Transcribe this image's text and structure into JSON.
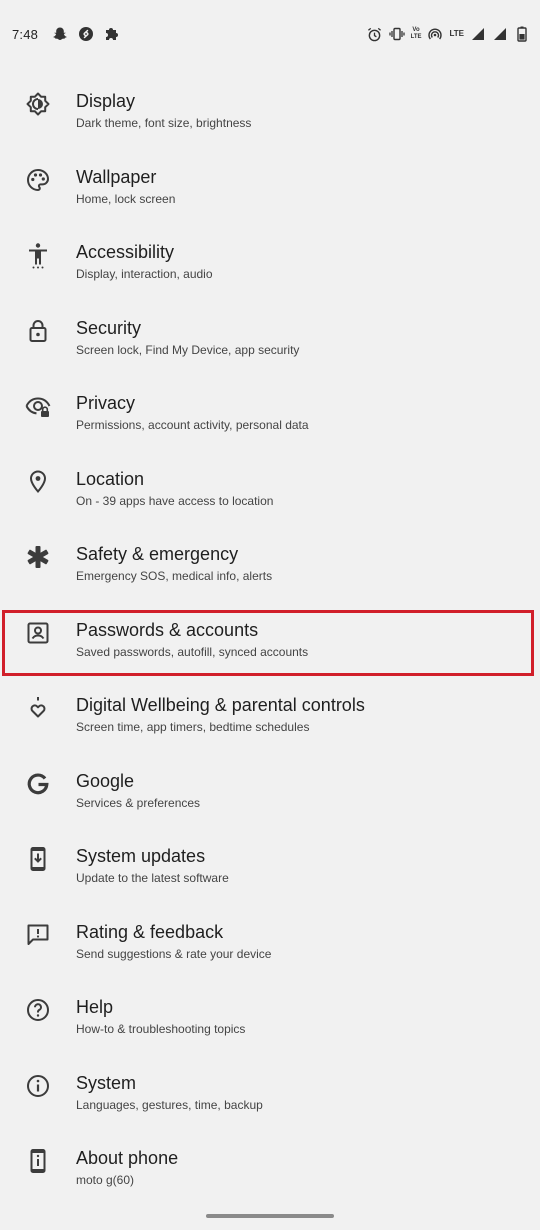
{
  "status_bar": {
    "time": "7:48",
    "left_icons": [
      "snapchat-icon",
      "shazam-icon",
      "puzzle-icon"
    ],
    "right_icons": [
      "alarm-icon",
      "vibrate-icon",
      "volte-icon",
      "hotspot-icon",
      "signal-icon",
      "signal-icon",
      "battery-icon"
    ],
    "volte_top": "Vo",
    "volte_bottom": "LTE",
    "lte_label": "LTE"
  },
  "settings": [
    {
      "title": "Display",
      "subtitle": "Dark theme, font size, brightness",
      "icon": "display-brightness-icon"
    },
    {
      "title": "Wallpaper",
      "subtitle": "Home, lock screen",
      "icon": "palette-icon"
    },
    {
      "title": "Accessibility",
      "subtitle": "Display, interaction, audio",
      "icon": "accessibility-icon"
    },
    {
      "title": "Security",
      "subtitle": "Screen lock, Find My Device, app security",
      "icon": "lock-icon"
    },
    {
      "title": "Privacy",
      "subtitle": "Permissions, account activity, personal data",
      "icon": "privacy-eye-icon"
    },
    {
      "title": "Location",
      "subtitle": "On - 39 apps have access to location",
      "icon": "location-pin-icon"
    },
    {
      "title": "Safety & emergency",
      "subtitle": "Emergency SOS, medical info, alerts",
      "icon": "asterisk-icon"
    },
    {
      "title": "Passwords & accounts",
      "subtitle": "Saved passwords, autofill, synced accounts",
      "icon": "account-box-icon"
    },
    {
      "title": "Digital Wellbeing & parental controls",
      "subtitle": "Screen time, app timers, bedtime schedules",
      "icon": "wellbeing-heart-icon"
    },
    {
      "title": "Google",
      "subtitle": "Services & preferences",
      "icon": "google-g-icon"
    },
    {
      "title": "System updates",
      "subtitle": "Update to the latest software",
      "icon": "system-update-icon"
    },
    {
      "title": "Rating & feedback",
      "subtitle": "Send suggestions & rate your device",
      "icon": "feedback-icon"
    },
    {
      "title": "Help",
      "subtitle": "How-to & troubleshooting topics",
      "icon": "help-icon"
    },
    {
      "title": "System",
      "subtitle": "Languages, gestures, time, backup",
      "icon": "info-icon"
    },
    {
      "title": "About phone",
      "subtitle": "moto g(60)",
      "icon": "phone-info-icon"
    }
  ],
  "colors": {
    "background": "#f1f1f1",
    "icon": "#3c3c3c",
    "highlight_border": "#d11f2a"
  }
}
